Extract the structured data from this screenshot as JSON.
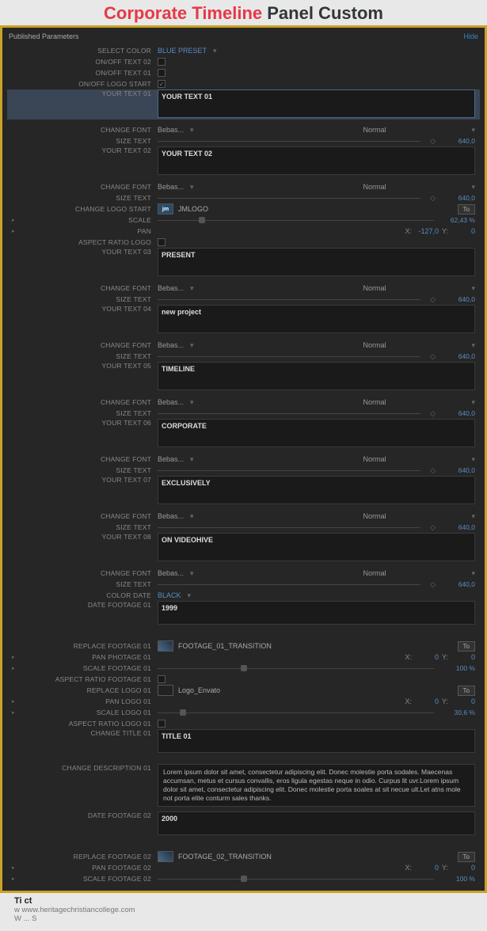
{
  "title": {
    "part1": "Corporate Timeline",
    "part2": " Panel Custom"
  },
  "panel": {
    "header": "Published Parameters",
    "hide": "Hide"
  },
  "selectColor": {
    "label": "SELECT COLOR",
    "value": "BLUE PRESET"
  },
  "onoffText02": {
    "label": "ON/OFF TEXT 02"
  },
  "onoffText01": {
    "label": "ON/OFF TEXT 01"
  },
  "onoffLogoStart": {
    "label": "ON/OFF LOGO START",
    "check": "✓"
  },
  "yourText01": {
    "label": "YOUR TEXT 01",
    "value": "YOUR TEXT 01"
  },
  "changeFont": {
    "label": "CHANGE FONT",
    "value": "Bebas...",
    "style": "Normal"
  },
  "sizeText": {
    "label": "SIZE TEXT",
    "value": "640,0"
  },
  "yourText02": {
    "label": "YOUR TEXT 02",
    "value": "YOUR TEXT 02"
  },
  "changeLogoStart": {
    "label": "CHANGE LOGO START",
    "value": "JMLOGO"
  },
  "scale": {
    "label": "Scale",
    "value": "62,43 %"
  },
  "pan": {
    "label": "Pan",
    "x": "-127,0",
    "y": "0"
  },
  "aspectRatioLogo": {
    "label": "ASPECT RATIO LOGO"
  },
  "yourText03": {
    "label": "YOUR TEXT 03",
    "value": "PRESENT"
  },
  "yourText04": {
    "label": "YOUR TEXT 04",
    "value": "new project"
  },
  "yourText05": {
    "label": "YOUR TEXT 05",
    "value": "TIMELINE"
  },
  "yourText06": {
    "label": "YOUR TEXT 06",
    "value": "CORPORATE"
  },
  "yourText07": {
    "label": "YOUR TEXT 07",
    "value": "EXCLUSIVELY"
  },
  "yourText08": {
    "label": "YOUR TEXT 08",
    "value": "ON VIDEOHIVE"
  },
  "colorDate": {
    "label": "COLOR DATE",
    "value": "BLACK"
  },
  "dateFootage01": {
    "label": "DATE FOOTAGE 01",
    "value": "1999"
  },
  "replaceFootage01": {
    "label": "REPLACE FOOTAGE 01",
    "value": "FOOTAGE_01_TRANSITION",
    "to": "To"
  },
  "panPhotage01": {
    "label": "PAN PHOTAGE 01",
    "x": "0",
    "y": "0"
  },
  "scaleFootage01": {
    "label": "SCALE FOOTAGE 01",
    "value": "100 %"
  },
  "aspectRatioFootage01": {
    "label": "ASPECT RATIO FOOTAGE 01"
  },
  "replaceLogo01": {
    "label": "REPLACE LOGO 01",
    "value": "Logo_Envato",
    "to": "To"
  },
  "panLogo01": {
    "label": "PAN LOGO 01",
    "x": "0",
    "y": "0"
  },
  "scaleLogo01": {
    "label": "SCALE LOGO 01",
    "value": "30,6 %"
  },
  "aspectRatioLogo01": {
    "label": "ASPECT RATIO LOGO 01"
  },
  "changeTitle01": {
    "label": "CHANGE TITLE 01",
    "value": "TITLE 01"
  },
  "changeDescription01": {
    "label": "CHANGE DESCRIPTION 01",
    "value": "Lorem ipsum dolor sit amet, consectetur adipiscing elit. Donec molestie porta sodales. Maecenas accumsan, metus et cursus convallis, eros ligula egestas   neque in odio. Curpus lit uvr.Lorem ipsum dolor sit amet, consectetur adipiscing elit. Donec molestie porta soales at sit necue ult.Let atns mole not porta elite conturm sales thanks."
  },
  "dateFootage02": {
    "label": "DATE FOOTAGE 02",
    "value": "2000"
  },
  "replaceFootage02": {
    "label": "REPLACE FOOTAGE 02",
    "value": "FOOTAGE_02_TRANSITION",
    "to": "To"
  },
  "panFootage02": {
    "label": "PAN FOOTAGE 02",
    "x": "0",
    "y": "0"
  },
  "scaleFootage02": {
    "label": "SCALE FOOTAGE 02",
    "value": "100 %"
  },
  "xylabel": {
    "x": "X:",
    "y": "Y:"
  },
  "footer": {
    "title": "Ti                                               ct",
    "link": "w       www.heritagechristiancollege.com",
    "meta": "W                                                                                                                                                                                  ...     S"
  }
}
